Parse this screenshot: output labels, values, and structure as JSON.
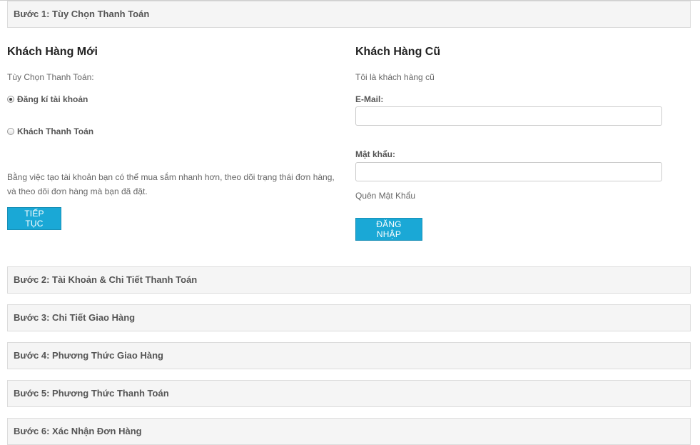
{
  "steps": [
    {
      "title": "Bước 1: Tùy Chọn Thanh Toán"
    },
    {
      "title": "Bước 2: Tài Khoản & Chi Tiết Thanh Toán"
    },
    {
      "title": "Bước 3: Chi Tiết Giao Hàng"
    },
    {
      "title": "Bước 4: Phương Thức Giao Hàng"
    },
    {
      "title": "Bước 5: Phương Thức Thanh Toán"
    },
    {
      "title": "Bước 6: Xác Nhận Đơn Hàng"
    }
  ],
  "new_customer": {
    "heading": "Khách Hàng Mới",
    "options_label": "Tùy Chọn Thanh Toán:",
    "radio_register": "Đăng kí tài khoản",
    "radio_guest": "Khách Thanh Toán",
    "selected_option": "register",
    "description": "Bằng việc tạo tài khoản bạn có thể mua sắm nhanh hơn, theo dõi trạng thái đơn hàng, và theo dõi đơn hàng mà bạn đã đặt.",
    "continue_button": "Tiếp tục"
  },
  "returning_customer": {
    "heading": "Khách Hàng Cũ",
    "subtitle": "Tôi là khách hàng cũ",
    "email_label": "E-Mail:",
    "email_value": "",
    "password_label": "Mật khẩu:",
    "password_value": "",
    "forgot_link": "Quên Mật Khẩu",
    "login_button": "Đăng nhập"
  },
  "colors": {
    "button": "#1aa8d6",
    "step_bar_bg": "#f5f5f5",
    "step_bar_border": "#dcdcdc"
  }
}
